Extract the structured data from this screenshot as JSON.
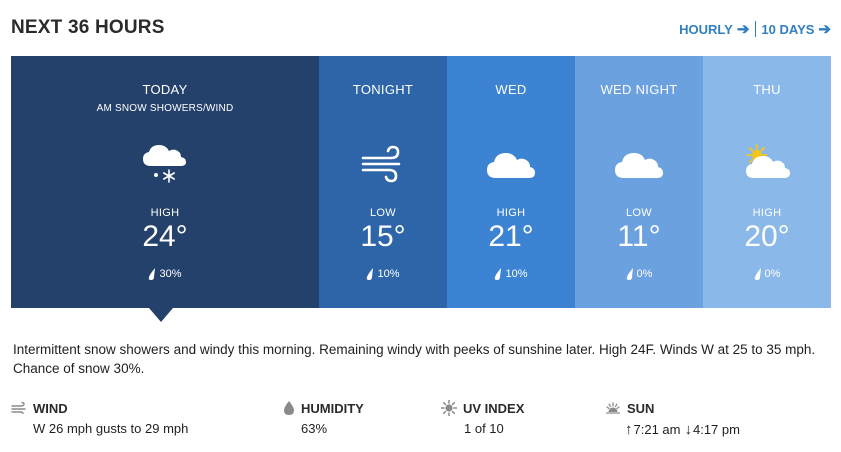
{
  "header": {
    "title": "NEXT 36 HOURS",
    "hourly_label": "HOURLY",
    "ten_days_label": "10 DAYS",
    "arrow": "➔"
  },
  "periods": [
    {
      "name": "TODAY",
      "condition": "AM SNOW SHOWERS/WIND",
      "icon": "cloud-snow-icon",
      "hl_label": "HIGH",
      "temp": "24°",
      "precip": "30%",
      "color": "#23416b"
    },
    {
      "name": "TONIGHT",
      "condition": "",
      "icon": "wind-icon",
      "hl_label": "LOW",
      "temp": "15°",
      "precip": "10%",
      "color": "#2d65a8"
    },
    {
      "name": "WED",
      "condition": "",
      "icon": "cloud-icon",
      "hl_label": "HIGH",
      "temp": "21°",
      "precip": "10%",
      "color": "#3d83d4"
    },
    {
      "name": "WED NIGHT",
      "condition": "",
      "icon": "cloud-icon",
      "hl_label": "LOW",
      "temp": "11°",
      "precip": "0%",
      "color": "#6aa1de"
    },
    {
      "name": "THU",
      "condition": "",
      "icon": "partly-sunny-icon",
      "hl_label": "HIGH",
      "temp": "20°",
      "precip": "0%",
      "color": "#8ab8e8"
    }
  ],
  "narrative": "Intermittent snow showers and windy this morning. Remaining windy with peeks of sunshine later. High 24F. Winds W at 25 to 35 mph. Chance of snow 30%.",
  "details": {
    "wind": {
      "label": "WIND",
      "value": "W 26 mph gusts to 29 mph",
      "icon": "wind-icon"
    },
    "humidity": {
      "label": "HUMIDITY",
      "value": "63%",
      "icon": "humidity-drop-icon"
    },
    "uv": {
      "label": "UV INDEX",
      "value": "1 of 10",
      "icon": "sun-icon"
    },
    "sun": {
      "label": "SUN",
      "sunrise": "7:21 am",
      "sunset": "4:17 pm",
      "up_arrow": "↑",
      "down_arrow": "↓",
      "icon": "sunrise-icon"
    }
  },
  "colors": {
    "accent_link": "#2f7fc1",
    "today": "#23416b",
    "tonight": "#2d65a8",
    "wed": "#3d83d4",
    "wed_night": "#6aa1de",
    "thu": "#8ab8e8"
  }
}
